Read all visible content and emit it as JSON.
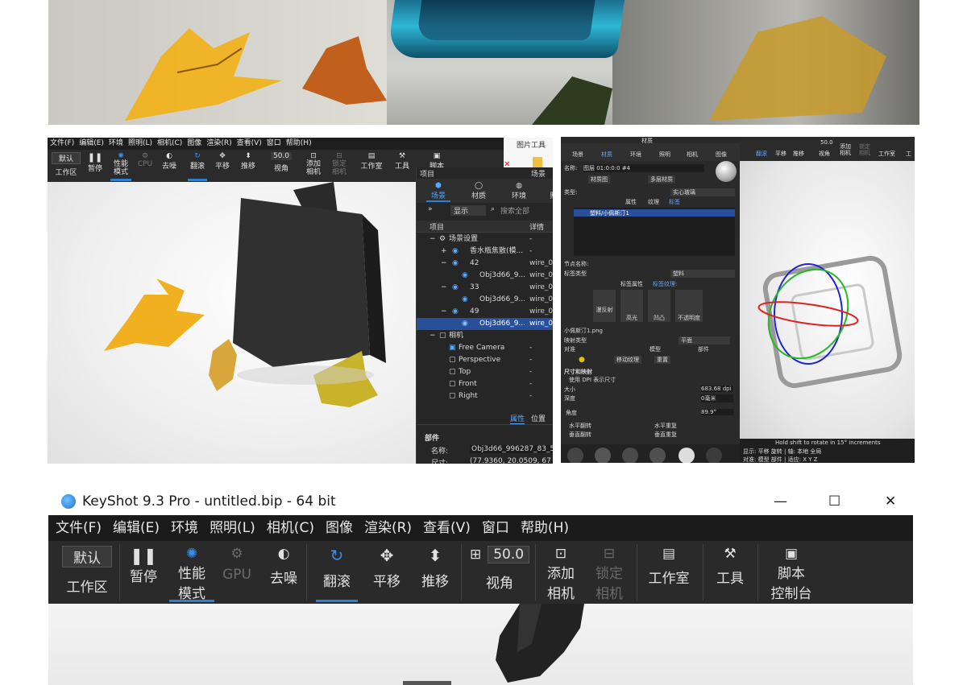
{
  "colors": {
    "accent": "#2d7fd6",
    "dark_bg": "#262626",
    "selection": "#2a4f9a"
  },
  "left_shot": {
    "menu": [
      "文件(F)",
      "编辑(E)",
      "环境",
      "照明(L)",
      "相机(C)",
      "图像",
      "渲染(R)",
      "查看(V)",
      "窗口",
      "帮助(H)"
    ],
    "toolbar": {
      "workspace_value": "默认",
      "workspace_label": "工作区",
      "pause": "暂停",
      "perf_mode": "性能\n模式",
      "gpu": "CPU",
      "denoise": "去噪",
      "tumble": "翻滚",
      "pan": "平移",
      "dolly": "推移",
      "fov_value": "50.0",
      "fov_label": "视角",
      "add_camera": "添加\n相机",
      "lock_camera": "锁定\n相机",
      "studio": "工作室",
      "tools": "工具",
      "script": "脚本"
    }
  },
  "picture_tools": {
    "label": "图片工具"
  },
  "scene_panel": {
    "header_left": "项目",
    "header_right": "场景",
    "tabs": [
      "场景",
      "材质",
      "环境",
      "照"
    ],
    "filter_value": "显示",
    "search_placeholder": "搜索全部",
    "col_item": "项目",
    "col_detail": "详情",
    "rows": [
      {
        "name": "场景设置",
        "detail": "-"
      },
      {
        "name": "香水瓶焦散(模...",
        "detail": "-"
      },
      {
        "name": "42",
        "detail": "wire_0"
      },
      {
        "name": "Obj3d66_9...",
        "detail": "wire_0"
      },
      {
        "name": "33",
        "detail": "wire_0"
      },
      {
        "name": "Obj3d66_9...",
        "detail": "wire_0"
      },
      {
        "name": "49",
        "detail": "wire_0"
      },
      {
        "name": "Obj3d66_9...",
        "detail": "wire_0"
      },
      {
        "name": "相机",
        "detail": ""
      },
      {
        "name": "Free Camera",
        "detail": "-"
      },
      {
        "name": "Perspective",
        "detail": "-"
      },
      {
        "name": "Top",
        "detail": "-"
      },
      {
        "name": "Front",
        "detail": "-"
      },
      {
        "name": "Right",
        "detail": "-"
      }
    ],
    "bottom_tabs": [
      "属性",
      "位置"
    ],
    "section": "部件",
    "name_label": "名称:",
    "name_value": "Obj3d66_996287_83_52",
    "size_label": "尺寸:",
    "size_value": "(77.9360, 20.0509, 67"
  },
  "right_shot": {
    "header_title": "材质",
    "top_tabs": [
      "场景",
      "材质",
      "环境",
      "照明",
      "相机",
      "图像"
    ],
    "name_label": "名称:",
    "name_value": "图层 01:0:0:0 #4",
    "btn_material_graph": "材质图",
    "btn_multi_material": "多层材质",
    "type_label": "类型:",
    "type_value": "实心玻璃",
    "sub_tabs": [
      "属性",
      "纹理",
      "标签"
    ],
    "label_item": "塑料/小佩斯汀1",
    "node_name_label": "节点名称:",
    "label_type_label": "标签类型",
    "label_type_value": "塑料",
    "tag_attr": "标签属性",
    "tag_texture": "标签纹理:",
    "slots": [
      "漫反射",
      "高光",
      "凹凸",
      "不透明度"
    ],
    "file_name": "小佩斯汀1.png",
    "map_type_label": "映射类型",
    "map_type_value": "平面",
    "align_label": "对准",
    "align_model": "模型",
    "align_part": "部件",
    "btn_move_texture": "移动纹理",
    "btn_reset": "重置",
    "size_map": "尺寸和映射",
    "use_dpi": "使用 DPI 表示尺寸",
    "size_label": "大小",
    "size_value": "683.68 dpi",
    "depth_label": "深度",
    "depth_value": "0毫米",
    "angle_label": "角度",
    "angle_value": "89.9°",
    "flip_h": "水平翻转",
    "repeat_h": "水平重复",
    "flip_v": "垂直翻转",
    "repeat_v": "垂直重复",
    "mini_toolbar": [
      "翻滚",
      "平移",
      "推移",
      "50.0",
      "视角",
      "添加\n相机",
      "锁定\n相机",
      "工作室",
      "工"
    ],
    "hint": "Hold shift to rotate in 15° increments",
    "status": "显示: 平移 旋转 | 轴: 本地 全局",
    "status2": "对准: 模型 部件 | 适应: X Y Z"
  },
  "bottom_shot": {
    "app_title": "KeyShot 9.3 Pro  - untitled.bip  - 64 bit",
    "menu": [
      "文件(F)",
      "编辑(E)",
      "环境",
      "照明(L)",
      "相机(C)",
      "图像",
      "渲染(R)",
      "查看(V)",
      "窗口",
      "帮助(H)"
    ],
    "toolbar": {
      "workspace_value": "默认",
      "workspace_label": "工作区",
      "pause": "暂停",
      "perf_mode_1": "性能",
      "perf_mode_2": "模式",
      "gpu": "GPU",
      "denoise": "去噪",
      "tumble": "翻滚",
      "pan": "平移",
      "dolly": "推移",
      "fov_value": "50.0",
      "fov_label": "视角",
      "add_camera_1": "添加",
      "add_camera_2": "相机",
      "lock_camera_1": "锁定",
      "lock_camera_2": "相机",
      "studio": "工作室",
      "tools": "工具",
      "script_1": "脚本",
      "script_2": "控制台"
    }
  }
}
